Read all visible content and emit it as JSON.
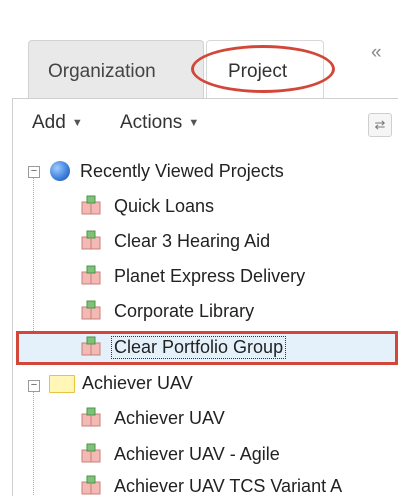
{
  "tabs": {
    "organization": "Organization",
    "project": "Project",
    "collapse": "«"
  },
  "toolbar": {
    "add": "Add",
    "actions": "Actions",
    "caret": "▼",
    "refresh": "⇄"
  },
  "tree": {
    "groups": [
      {
        "label": "Recently Viewed Projects",
        "toggle": "−",
        "icon": "globe-icon",
        "items": [
          "Quick Loans",
          "Clear 3 Hearing Aid",
          "Planet Express Delivery",
          "Corporate Library",
          "Clear Portfolio Group"
        ]
      },
      {
        "label": "Achiever UAV",
        "toggle": "−",
        "icon": "folder-icon",
        "items": [
          "Achiever UAV",
          "Achiever UAV - Agile",
          "Achiever UAV TCS Variant A"
        ]
      }
    ],
    "selected_item": "Clear Portfolio Group"
  },
  "colors": {
    "highlight": "#d2473a",
    "selected_bg": "#e4f1fb"
  }
}
